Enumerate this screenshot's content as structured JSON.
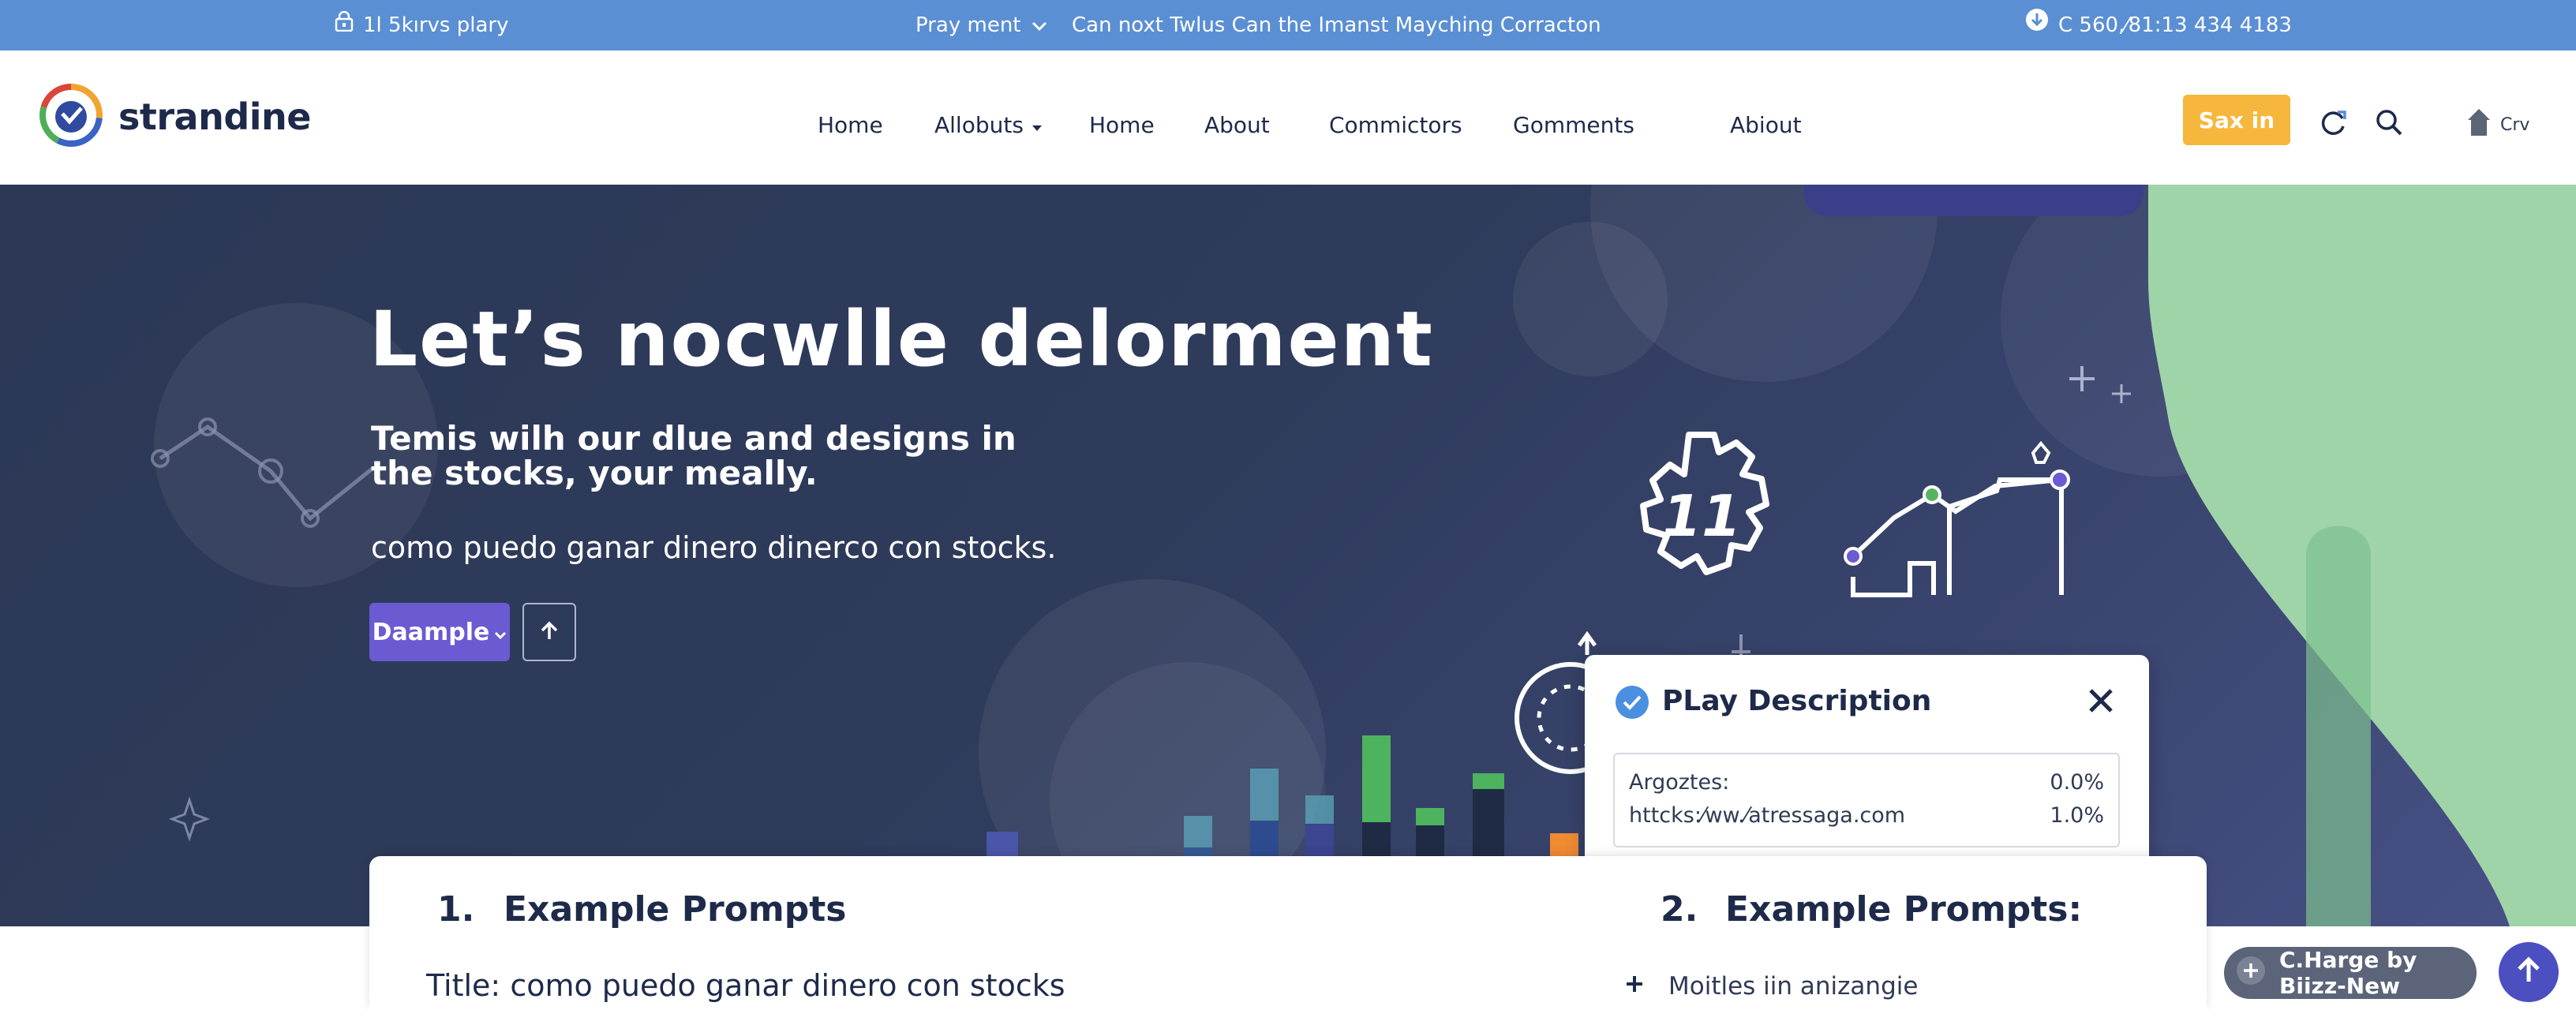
{
  "topbar": {
    "left_text": "1l 5kırvs plary",
    "menu_text": "Pray ment",
    "announcement": "Can noxt Twlus Can the Imanst Mayching Corracton",
    "phone": "C 560,⁄81:13 434 4183"
  },
  "header": {
    "brand": "strandine",
    "nav": [
      "Home",
      "Allobuts",
      "Home",
      "About",
      "Commictors",
      "Gomments",
      "Abiout"
    ],
    "signin_label": "Sax in",
    "profile_label": "Crv"
  },
  "hero": {
    "title": "Let’s nocwlle delorment",
    "subtitle": "Temis wilh our dlue and designs in the stocks, your meally.",
    "description": "como puedo ganar dinero dinerco con stocks.",
    "primary_button": "Daample",
    "illustration_number": "11"
  },
  "popup": {
    "title": "PLay Description",
    "rows": [
      {
        "label": "Argoztes:",
        "value": "0.0%"
      },
      {
        "label": "httcks:⁄ww.⁄atressaga.com",
        "value": "1.0%"
      }
    ]
  },
  "card": {
    "left_number": "1.",
    "left_title": "Example Prompts",
    "right_number": "2.",
    "right_title": "Example Prompts:",
    "body_title": "Title: como puedo ganar dinero con stocks",
    "list_item": "Moitles iin anizangie"
  },
  "chat": {
    "label": "C.Harge by Biizz-New"
  },
  "colors": {
    "topbar": "#5a8fd4",
    "hero_bg": "#2f3b5b",
    "accent_yellow": "#f6b73c",
    "accent_purple": "#6b5bd2",
    "accent_green": "#9fd4a8"
  }
}
